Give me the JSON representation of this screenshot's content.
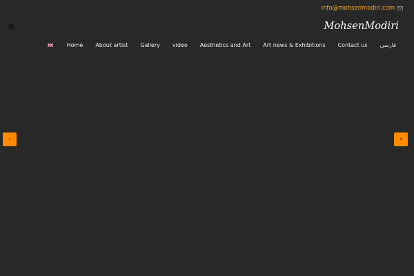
{
  "header": {
    "email": "info@mohsenmodiri.com",
    "logo": "MohsenModiri"
  },
  "nav": {
    "items": [
      {
        "label": "Home"
      },
      {
        "label": "About artist"
      },
      {
        "label": "Gallery"
      },
      {
        "label": "video"
      },
      {
        "label": "Aesthetics and Art"
      },
      {
        "label": "Art news & Exhibitions"
      },
      {
        "label": "Contact us"
      },
      {
        "label": "فارسی"
      }
    ]
  },
  "slider": {
    "prev_glyph": "‹",
    "next_glyph": "›"
  },
  "colors": {
    "background": "#282828",
    "accent": "#ff8c00",
    "email": "#f5a623"
  },
  "icons": {
    "search": "search-icon",
    "mail": "mail-icon",
    "flag": "uk-flag-icon"
  }
}
